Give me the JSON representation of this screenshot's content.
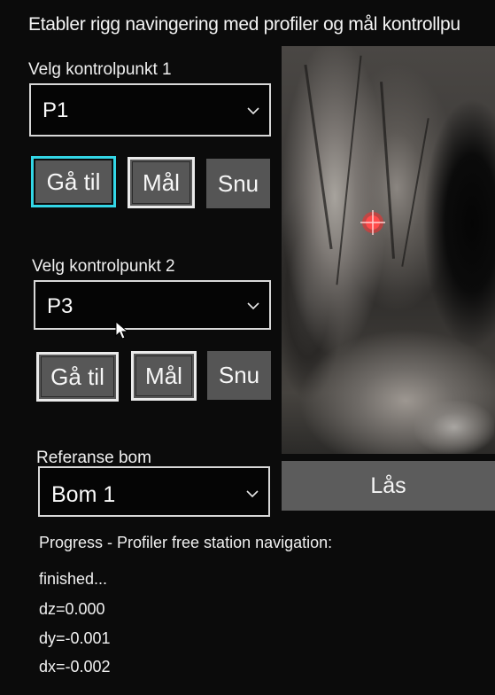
{
  "header": {
    "title": "Etabler rigg navingering med profiler og mål kontrollpu"
  },
  "controlpoint1": {
    "label": "Velg kontrolpunkt 1",
    "selected": "P1",
    "goto_label": "Gå til",
    "measure_label": "Mål",
    "turn_label": "Snu"
  },
  "controlpoint2": {
    "label": "Velg kontrolpunkt 2",
    "selected": "P3",
    "goto_label": "Gå til",
    "measure_label": "Mål",
    "turn_label": "Snu"
  },
  "reference": {
    "label": "Referanse bom",
    "selected": "Bom 1",
    "lock_label": "Lås"
  },
  "progress": {
    "lines": [
      "Progress - Profiler free station navigation:",
      "finished...",
      "dz=0.000",
      "dy=-0.001",
      "dx=-0.002"
    ]
  },
  "icons": {
    "dropdown": "chevron-down-icon",
    "target": "crosshair-target-icon",
    "cursor": "mouse-pointer-icon"
  },
  "colors": {
    "background": "#0b0b0b",
    "focus_border": "#33d6e6",
    "target": "#ff2a2a",
    "button": "#575757"
  }
}
